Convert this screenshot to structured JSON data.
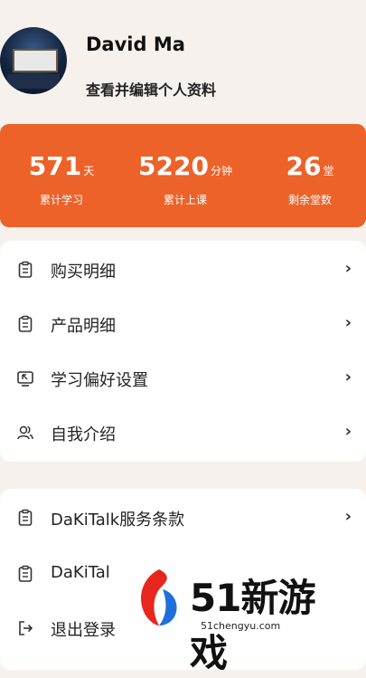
{
  "profile": {
    "name": "David Ma",
    "edit_label": "查看并编辑个人资料"
  },
  "stats": [
    {
      "value": "571",
      "unit": "天",
      "label": "累计学习"
    },
    {
      "value": "5220",
      "unit": "分钟",
      "label": "累计上课"
    },
    {
      "value": "26",
      "unit": "堂",
      "label": "剩余堂数"
    }
  ],
  "menu1": [
    {
      "label": "购买明细",
      "icon": "clipboard-icon"
    },
    {
      "label": "产品明细",
      "icon": "clipboard-icon"
    },
    {
      "label": "学习偏好设置",
      "icon": "monitor-cursor-icon"
    },
    {
      "label": "自我介绍",
      "icon": "users-icon"
    }
  ],
  "menu2": [
    {
      "label": "DaKiTalk服务条款",
      "icon": "clipboard-icon"
    },
    {
      "label": "DaKiTal",
      "icon": "clipboard-icon"
    },
    {
      "label": "退出登录",
      "icon": "logout-icon"
    }
  ],
  "watermark": {
    "brand": "51新游戏",
    "url": "51chengyu.com"
  },
  "colors": {
    "accent": "#ec6229",
    "background": "#f7f1ee"
  }
}
